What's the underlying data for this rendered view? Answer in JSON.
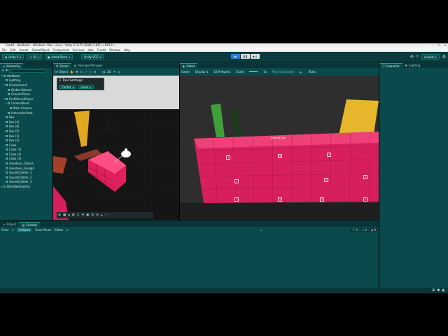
{
  "window": {
    "title": "Frostd - devRoom - Windows, Mac, Linux - Unity 6.3 LTS (6000.3.8f1) <DX12>",
    "controls": [
      "–",
      "☐",
      "✕"
    ]
  },
  "menu": [
    "File",
    "Edit",
    "Assets",
    "GameObject",
    "Component",
    "Services",
    "Jobs",
    "Frostd",
    "Window",
    "Help"
  ],
  "toolbar": {
    "account": "Unity 6",
    "ai": "AI",
    "asset_store": "Asset Store",
    "vcs": "Unity VCS",
    "layout": "Layout",
    "play_icons": [
      "▶",
      "❚❚",
      "▶❙"
    ]
  },
  "hierarchy": {
    "tab": "Hierarchy",
    "search_placeholder": "All",
    "items": [
      {
        "label": "devRoom",
        "indent": 0,
        "root": true
      },
      {
        "label": "Lighting",
        "indent": 1
      },
      {
        "label": "Environment",
        "indent": 1
      },
      {
        "label": "Global Volume",
        "indent": 2
      },
      {
        "label": "Ground Plane",
        "indent": 2
      },
      {
        "label": "FirstPersonPlayer",
        "indent": 1
      },
      {
        "label": "CameraPivot",
        "indent": 2
      },
      {
        "label": "Main Camera",
        "indent": 3
      },
      {
        "label": "InteractionProb",
        "indent": 2
      },
      {
        "label": "Box",
        "indent": 1
      },
      {
        "label": "Box (4)",
        "indent": 1
      },
      {
        "label": "Box (6)",
        "indent": 1
      },
      {
        "label": "Box (5)",
        "indent": 1
      },
      {
        "label": "Box (1)",
        "indent": 1
      },
      {
        "label": "Box (2)",
        "indent": 1
      },
      {
        "label": "Cube",
        "indent": 1
      },
      {
        "label": "Cube (1)",
        "indent": 1
      },
      {
        "label": "Cube (2)",
        "indent": 1
      },
      {
        "label": "Cube (3)",
        "indent": 1
      },
      {
        "label": "mendixes_TakerA",
        "indent": 1
      },
      {
        "label": "mendixes_AsiaglA",
        "indent": 1
      },
      {
        "label": "SoundCollider_1",
        "indent": 1
      },
      {
        "label": "SoundCollider_2",
        "indent": 1
      },
      {
        "label": "SoundCollider_3",
        "indent": 1
      },
      {
        "label": "DontDestroyOnL",
        "indent": 0,
        "root": true
      }
    ]
  },
  "scene": {
    "tab_scene": "Scene",
    "tab_package": "Package Manager",
    "view_mode": "ne Object",
    "tool_settings_title": "Tool Settings",
    "pivot": "Center",
    "space": "Local",
    "mode_2d": "2D"
  },
  "game": {
    "tab": "Game",
    "mode": "Game",
    "display": "Display 1",
    "aspect": "16:9 Aspect",
    "scale_label": "Scale",
    "scale_value": "1x",
    "play_focus": "Play Unfocused",
    "stats": "Stats",
    "hud_text": "[Space] Idle",
    "marks": [
      "1",
      "1",
      "1",
      "1",
      "1",
      "1",
      "1",
      "1",
      "1",
      "1"
    ]
  },
  "inspector": {
    "tab_inspector": "Inspector",
    "tab_lighting": "Lighting"
  },
  "bottom": {
    "tab_project": "Project",
    "tab_console": "Console",
    "clear": "Clear",
    "collapse": "Collapse",
    "error_pause": "Error Pause",
    "editor": "Editor",
    "count_logs": "0",
    "count_warnings": "0",
    "count_errors": "0"
  },
  "colors": {
    "accent": "#2a9b93",
    "panel_bg": "#0a4a4c",
    "pink_wall": "#d81f5e",
    "yellow_pillar": "#e8b62c",
    "green_pillar": "#3a9a32"
  }
}
